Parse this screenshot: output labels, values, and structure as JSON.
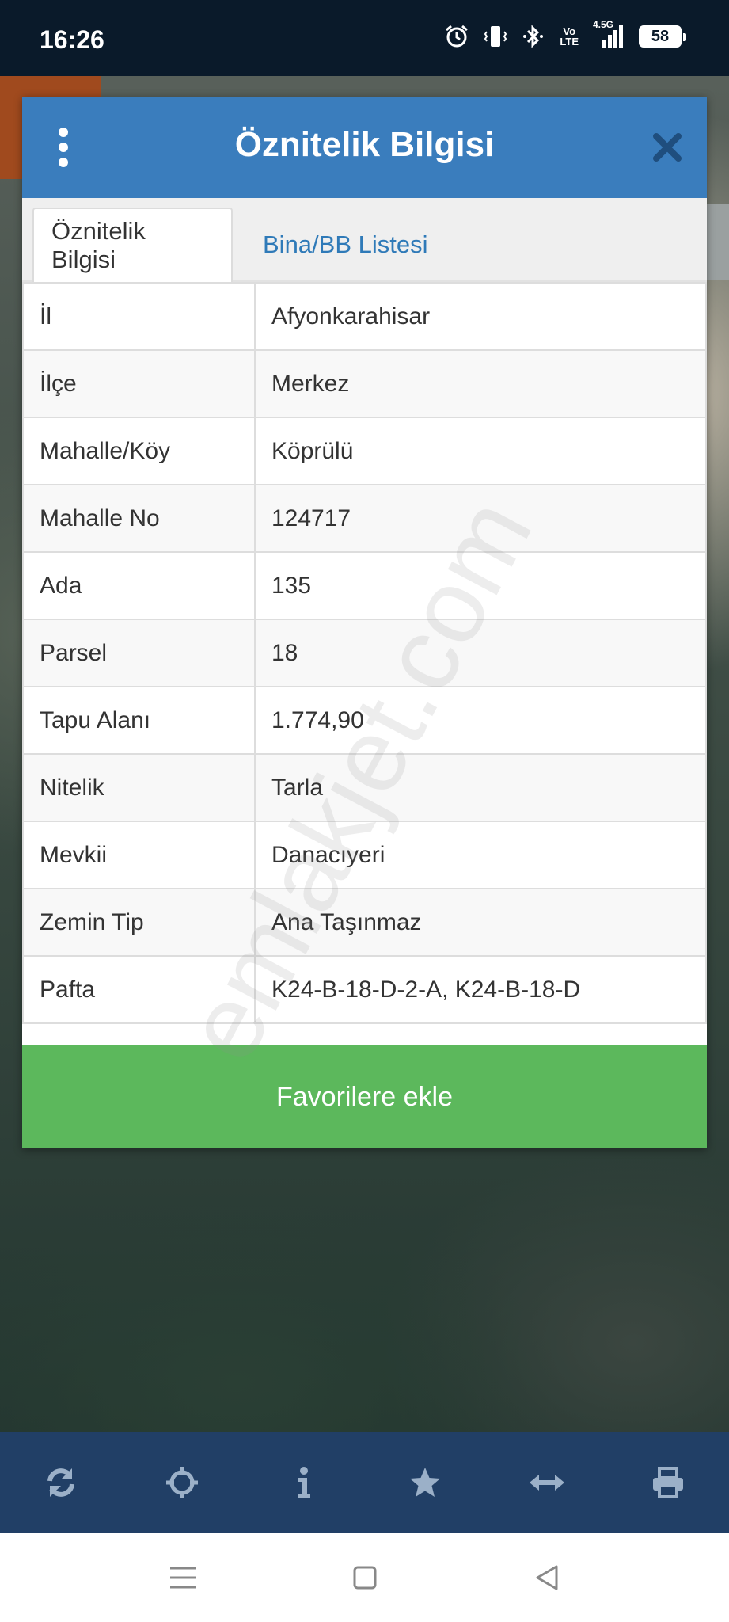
{
  "status_bar": {
    "time": "16:26",
    "network": "4.5G",
    "volte_line1": "Vo",
    "volte_line2": "LTE",
    "battery": "58"
  },
  "dialog": {
    "title": "Öznitelik Bilgisi",
    "tabs": [
      {
        "label": "Öznitelik Bilgisi",
        "active": true
      },
      {
        "label": "Bina/BB Listesi",
        "active": false
      }
    ],
    "rows": [
      {
        "key": "İl",
        "value": "Afyonkarahisar"
      },
      {
        "key": "İlçe",
        "value": "Merkez"
      },
      {
        "key": "Mahalle/Köy",
        "value": "Köprülü"
      },
      {
        "key": "Mahalle No",
        "value": "124717"
      },
      {
        "key": "Ada",
        "value": "135"
      },
      {
        "key": "Parsel",
        "value": "18"
      },
      {
        "key": "Tapu Alanı",
        "value": "1.774,90"
      },
      {
        "key": "Nitelik",
        "value": "Tarla"
      },
      {
        "key": "Mevkii",
        "value": "Danacıyeri"
      },
      {
        "key": "Zemin Tip",
        "value": "Ana Taşınmaz"
      },
      {
        "key": "Pafta",
        "value": "K24-B-18-D-2-A, K24-B-18-D"
      }
    ],
    "favorite_button": "Favorilere ekle"
  },
  "watermark": "emlakjet.com",
  "toolbar_icons": [
    "refresh-icon",
    "crosshair-icon",
    "info-icon",
    "star-icon",
    "arrows-horizontal-icon",
    "print-icon"
  ],
  "colors": {
    "header": "#3a7dbd",
    "tab_link": "#2f7ab8",
    "favorite": "#5cb85c",
    "toolbar": "#213f66"
  }
}
